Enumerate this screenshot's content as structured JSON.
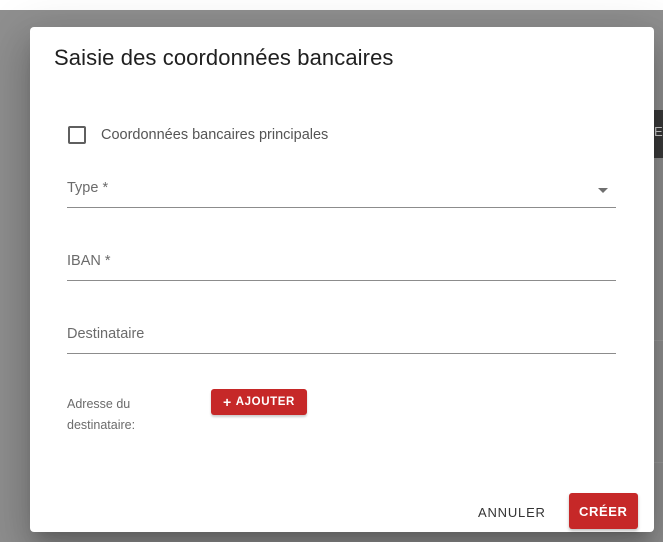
{
  "backdrop": {
    "tab_letter": "E"
  },
  "dialog": {
    "title": "Saisie des coordonnées bancaires",
    "checkbox": {
      "label": "Coordonnées bancaires principales",
      "checked": false
    },
    "fields": {
      "type": {
        "label": "Type *",
        "value": ""
      },
      "iban": {
        "label": "IBAN *",
        "value": ""
      },
      "destinataire": {
        "label": "Destinataire",
        "value": ""
      }
    },
    "address": {
      "label_line1": "Adresse du",
      "label_line2": "destinataire:",
      "add_button_label": "AJOUTER",
      "add_button_icon": "plus-icon"
    },
    "actions": {
      "cancel_label": "ANNULER",
      "create_label": "CRÉER"
    }
  },
  "colors": {
    "primary": "#c62828",
    "overlay": "#8f8f8f",
    "text": "#202020"
  }
}
